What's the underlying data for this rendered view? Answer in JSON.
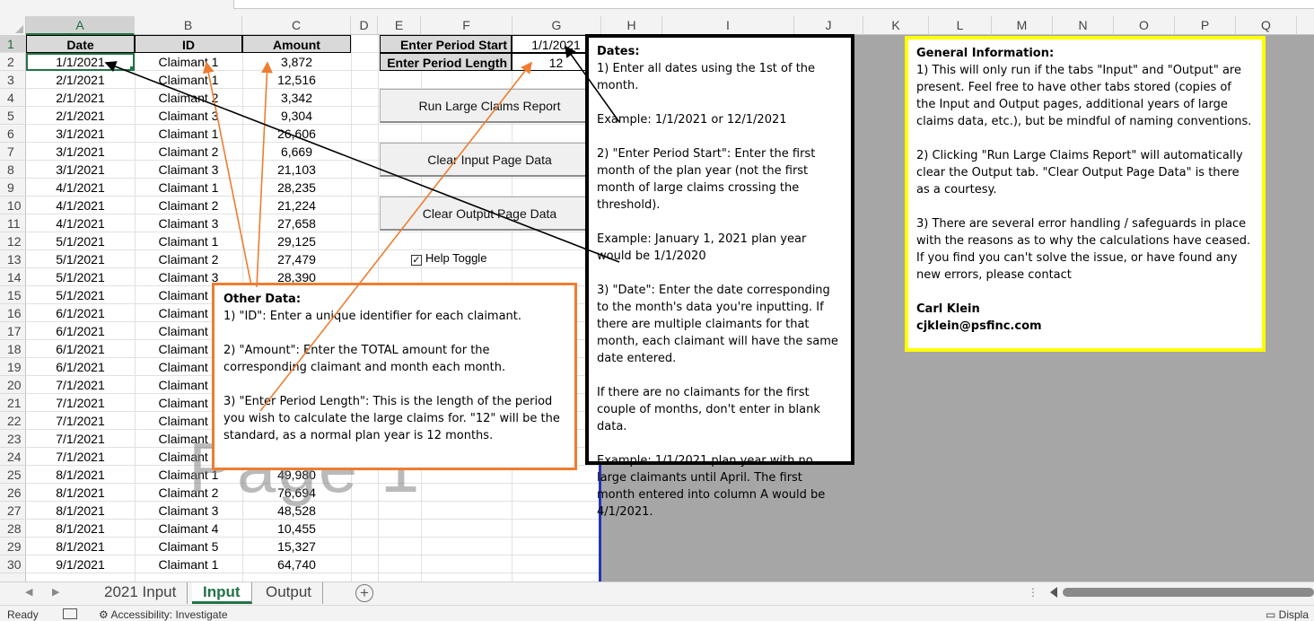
{
  "columns": [
    "A",
    "B",
    "C",
    "D",
    "E",
    "F",
    "G",
    "H",
    "I",
    "J",
    "K",
    "L",
    "M",
    "N",
    "O",
    "P",
    "Q"
  ],
  "rows": [
    "1",
    "2",
    "3",
    "4",
    "5",
    "6",
    "7",
    "8",
    "9",
    "10",
    "11",
    "12",
    "13",
    "14",
    "15",
    "16",
    "17",
    "18",
    "19",
    "20",
    "21",
    "22",
    "23",
    "24",
    "25",
    "26",
    "27",
    "28",
    "29",
    "30"
  ],
  "table": {
    "headers": {
      "date": "Date",
      "id": "ID",
      "amount": "Amount"
    },
    "rows": [
      {
        "date": "1/1/2021",
        "id": "Claimant 1",
        "amount": "3,872"
      },
      {
        "date": "2/1/2021",
        "id": "Claimant 1",
        "amount": "12,516"
      },
      {
        "date": "2/1/2021",
        "id": "Claimant 2",
        "amount": "3,342"
      },
      {
        "date": "2/1/2021",
        "id": "Claimant 3",
        "amount": "9,304"
      },
      {
        "date": "3/1/2021",
        "id": "Claimant 1",
        "amount": "26,606"
      },
      {
        "date": "3/1/2021",
        "id": "Claimant 2",
        "amount": "6,669"
      },
      {
        "date": "3/1/2021",
        "id": "Claimant 3",
        "amount": "21,103"
      },
      {
        "date": "4/1/2021",
        "id": "Claimant 1",
        "amount": "28,235"
      },
      {
        "date": "4/1/2021",
        "id": "Claimant 2",
        "amount": "21,224"
      },
      {
        "date": "4/1/2021",
        "id": "Claimant 3",
        "amount": "27,658"
      },
      {
        "date": "5/1/2021",
        "id": "Claimant 1",
        "amount": "29,125"
      },
      {
        "date": "5/1/2021",
        "id": "Claimant 2",
        "amount": "27,479"
      },
      {
        "date": "5/1/2021",
        "id": "Claimant 3",
        "amount": "28,390"
      },
      {
        "date": "5/1/2021",
        "id": "Claimant 4",
        "amount": ""
      },
      {
        "date": "6/1/2021",
        "id": "Claimant 1",
        "amount": ""
      },
      {
        "date": "6/1/2021",
        "id": "Claimant 2",
        "amount": ""
      },
      {
        "date": "6/1/2021",
        "id": "Claimant 3",
        "amount": ""
      },
      {
        "date": "6/1/2021",
        "id": "Claimant 4",
        "amount": ""
      },
      {
        "date": "7/1/2021",
        "id": "Claimant 1",
        "amount": ""
      },
      {
        "date": "7/1/2021",
        "id": "Claimant 2",
        "amount": ""
      },
      {
        "date": "7/1/2021",
        "id": "Claimant 3",
        "amount": ""
      },
      {
        "date": "7/1/2021",
        "id": "Claimant 4",
        "amount": ""
      },
      {
        "date": "7/1/2021",
        "id": "Claimant 5",
        "amount": ""
      },
      {
        "date": "8/1/2021",
        "id": "Claimant 1",
        "amount": "49,980"
      },
      {
        "date": "8/1/2021",
        "id": "Claimant 2",
        "amount": "76,694"
      },
      {
        "date": "8/1/2021",
        "id": "Claimant 3",
        "amount": "48,528"
      },
      {
        "date": "8/1/2021",
        "id": "Claimant 4",
        "amount": "10,455"
      },
      {
        "date": "8/1/2021",
        "id": "Claimant 5",
        "amount": "15,327"
      },
      {
        "date": "9/1/2021",
        "id": "Claimant 1",
        "amount": "64,740"
      }
    ]
  },
  "params": {
    "period_start_label": "Enter Period Start",
    "period_start_value": "1/1/2021",
    "period_length_label": "Enter Period Length",
    "period_length_value": "12"
  },
  "buttons": {
    "run_report": "Run Large Claims Report",
    "clear_input": "Clear Input Page Data",
    "clear_output": "Clear Output Page Data"
  },
  "help_toggle": {
    "label": "Help Toggle",
    "checked": true
  },
  "watermark": "Page 1",
  "notes": {
    "other": {
      "title": "Other Data:",
      "p1": "1) \"ID\": Enter a unique identifier for each claimant.",
      "p2": "2) \"Amount\": Enter the TOTAL amount for the corresponding claimant and month each month.",
      "p3": "3) \"Enter Period Length\": This is the length of the period you wish to calculate the large claims for. \"12\" will be the standard, as a normal plan year is 12 months."
    },
    "dates": {
      "title": "Dates:",
      "p1": "1) Enter all dates using the 1st of the month.",
      "p2": "Example: 1/1/2021 or 12/1/2021",
      "p3": "2) \"Enter Period Start\": Enter the first month of the plan year (not the first month of large claims crossing the threshold).",
      "p4": "Example: January 1, 2021 plan year would be 1/1/2020",
      "p5": "3) \"Date\": Enter the date corresponding to the month's data you're inputting. If there are multiple claimants for that month, each claimant will have the same date entered.",
      "p6": "If there are no claimants for the first couple of months, don't enter in blank data.",
      "p7": "Example: 1/1/2021 plan year with no large claimants until April. The first month entered into column A would be 4/1/2021."
    },
    "general": {
      "title": "General Information:",
      "p1": "1) This will only run if the tabs \"Input\" and \"Output\" are present. Feel free to have other tabs stored (copies of the Input and Output pages, additional years of large claims data, etc.), but be mindful of naming conventions.",
      "p2": "2) Clicking \"Run Large Claims Report\" will automatically clear the Output tab. \"Clear Output Page Data\" is there as a courtesy.",
      "p3": "3) There are several error handling / safeguards in place with the reasons as to why the calculations have ceased. If you find you can't solve the issue, or have found any new errors, please contact",
      "contact_name": "Carl Klein",
      "contact_email": "cjklein@psfinc.com"
    }
  },
  "tabs": [
    {
      "label": "2021 Input",
      "active": false
    },
    {
      "label": "Input",
      "active": true
    },
    {
      "label": "Output",
      "active": false
    }
  ],
  "status": {
    "ready": "Ready",
    "accessibility": "Accessibility: Investigate",
    "display": "Displa"
  },
  "colors": {
    "excel_green": "#217346",
    "orange_note": "#ed7d31",
    "yellow_note": "#ffff00",
    "blue_border": "#2334b8"
  }
}
